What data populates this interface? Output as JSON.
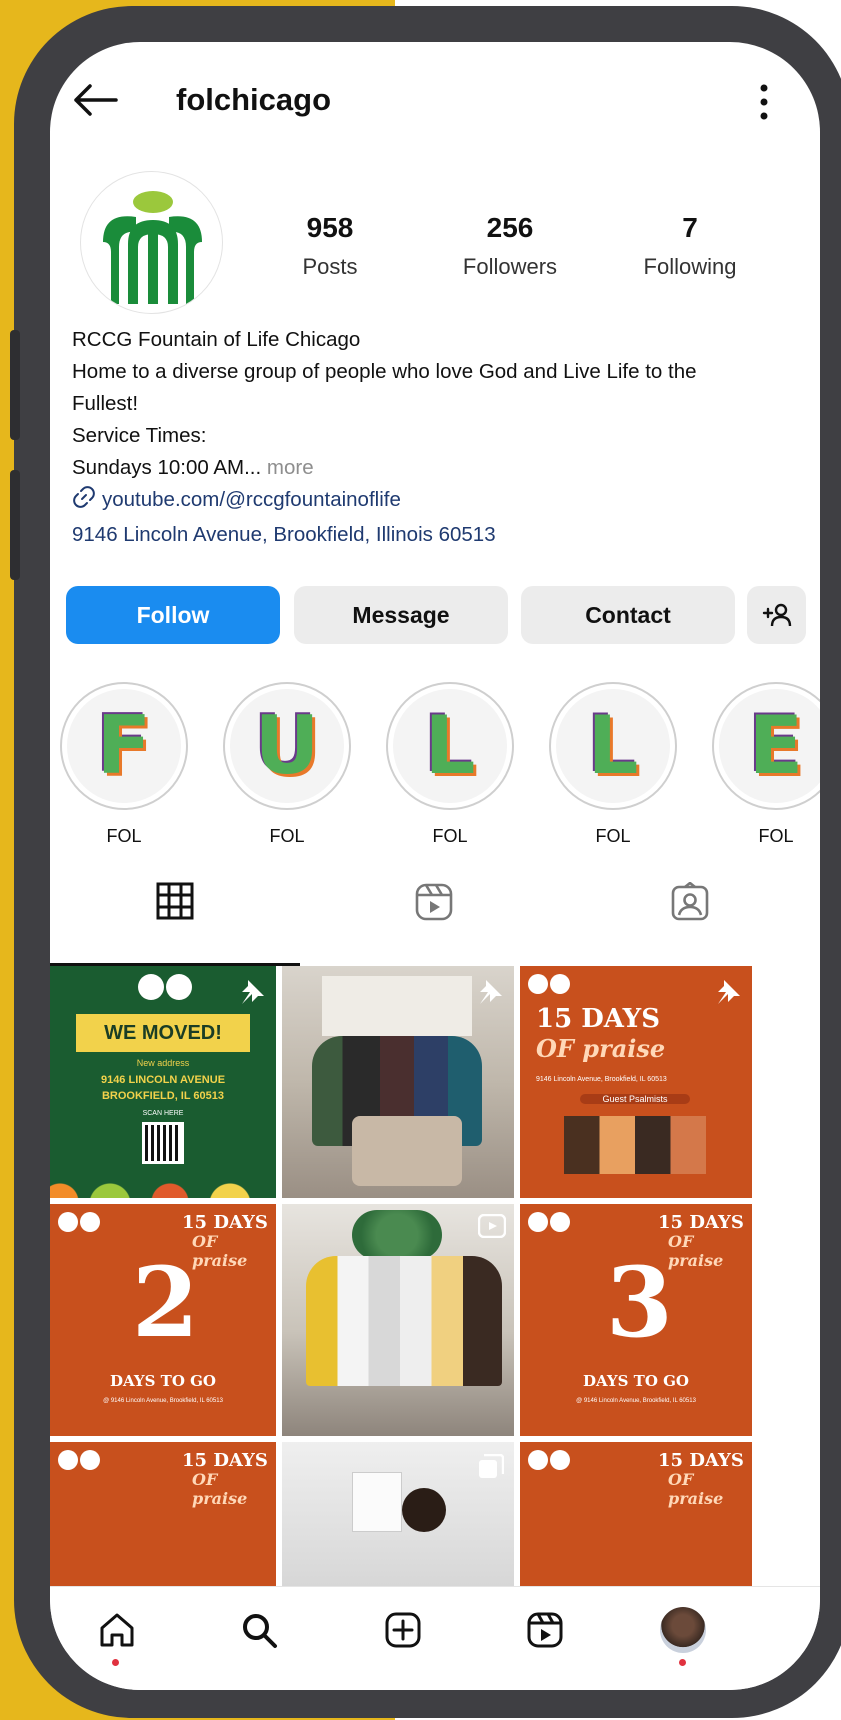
{
  "header": {
    "username": "folchicago",
    "back_icon": "arrow-left-icon",
    "more_icon": "more-vertical-icon"
  },
  "profile": {
    "stats": [
      {
        "value": "958",
        "label": "Posts"
      },
      {
        "value": "256",
        "label": "Followers"
      },
      {
        "value": "7",
        "label": "Following"
      }
    ],
    "name": "RCCG Fountain of Life Chicago",
    "bio_line1": "Home to a diverse group of people who love God and Live Life to the",
    "bio_line2": "Fullest!",
    "bio_line3": "Service Times:",
    "bio_line4": "Sundays 10:00 AM...",
    "more_label": " more",
    "link": "youtube.com/@rccgfountainoflife",
    "address": "9146 Lincoln Avenue, Brookfield, Illinois 60513"
  },
  "actions": {
    "follow": "Follow",
    "message": "Message",
    "contact": "Contact",
    "add_user_icon": "add-user-icon"
  },
  "highlights": [
    {
      "letter": "F",
      "label": "FOL"
    },
    {
      "letter": "U",
      "label": "FOL"
    },
    {
      "letter": "L",
      "label": "FOL"
    },
    {
      "letter": "L",
      "label": "FOL"
    },
    {
      "letter": "E",
      "label": "FOL"
    }
  ],
  "tabs": [
    "grid-icon",
    "reels-icon",
    "tagged-icon"
  ],
  "posts": {
    "p1": {
      "title": "WE MOVED!",
      "sub": "New address",
      "addr1": "9146 LINCOLN AVENUE",
      "addr2": "BROOKFIELD, IL 60513",
      "scan": "SCAN HERE"
    },
    "p3": {
      "title1": "15 DAYS",
      "title2": "OF praise",
      "addr": "9146 Lincoln Avenue, Brookfield, IL 60513",
      "guest": "Guest Psalmists"
    },
    "p4": {
      "title1": "15 DAYS",
      "title2": "OF praise",
      "number": "2",
      "caption": "DAYS TO GO",
      "addr": "@ 9146 Lincoln Avenue, Brookfield, IL 60513"
    },
    "p6": {
      "title1": "15 DAYS",
      "title2": "OF praise",
      "number": "3",
      "caption": "DAYS TO GO",
      "addr": "@ 9146 Lincoln Avenue, Brookfield, IL 60513"
    },
    "p7": {
      "title1": "15 DAYS",
      "title2": "OF praise"
    },
    "p9": {
      "title1": "15 DAYS",
      "title2": "OF praise"
    }
  },
  "bottom_nav": [
    "home-icon",
    "search-icon",
    "create-icon",
    "reels-icon",
    "profile-avatar"
  ],
  "colors": {
    "accent": "#1a8cf0",
    "frame": "#3f3f43",
    "background_accent": "#e6b71c",
    "post_green": "#1a5c30",
    "post_orange": "#c8501d"
  }
}
